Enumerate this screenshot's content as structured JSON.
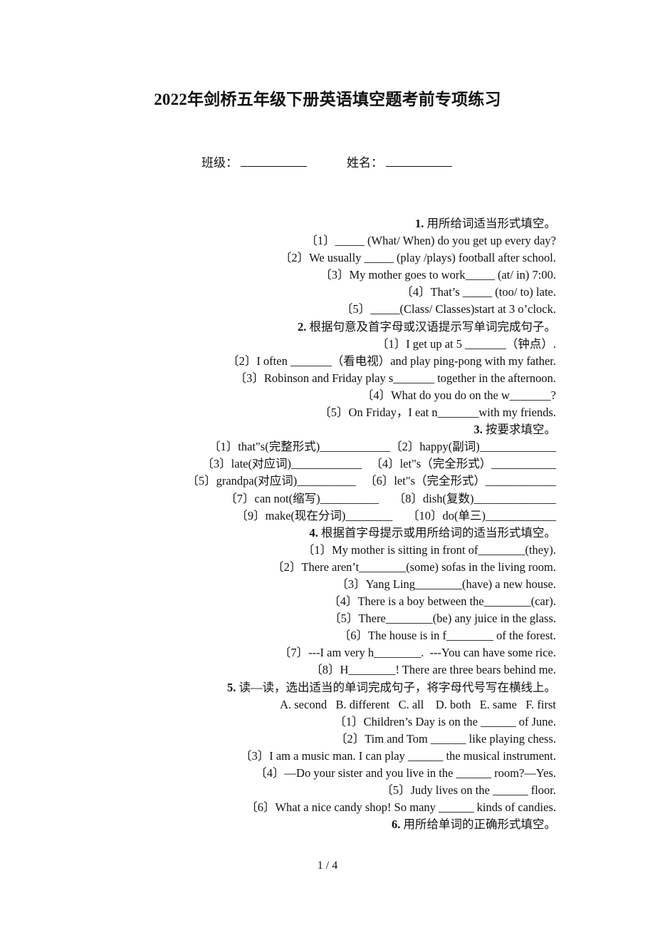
{
  "title": "2022年剑桥五年级下册英语填空题考前专项练习",
  "info": {
    "class_label": "班级：",
    "name_label": "姓名："
  },
  "sections": [
    {
      "number": "1.",
      "heading": "用所给词适当形式填空。",
      "lines": [
        "〔1〕_____ (What/ When) do you get up every day?",
        "〔2〕We usually _____ (play /plays) football after school.",
        "〔3〕My mother goes to work_____ (at/ in) 7:00.",
        "〔4〕That’s _____ (too/ to) late.",
        "〔5〕_____(Class/ Classes)start at 3 o’clock."
      ]
    },
    {
      "number": "2.",
      "heading": "根据句意及首字母或汉语提示写单词完成句子。",
      "lines": [
        "〔1〕I get up at 5 _______（钟点）.",
        "〔2〕I often _______（看电视）and play ping-pong with my father.",
        "〔3〕Robinson and Friday play s_______ together in the afternoon.",
        "〔4〕What do you do on the w_______?",
        "〔5〕On Friday，I eat n_______with my friends."
      ]
    },
    {
      "number": "3.",
      "heading": "按要求填空。",
      "lines": [
        "〔1〕that\"s(完整形式)____________〔2〕happy(副词)_____________",
        "〔3〕late(对应词)____________   〔4〕let\"s（完全形式）___________",
        "〔5〕grandpa(对应词)__________   〔6〕let\"s（完全形式）____________",
        "〔7〕can not(缩写)__________     〔8〕dish(复数)______________",
        "〔9〕make(现在分词)________     〔10〕do(单三)____________"
      ]
    },
    {
      "number": "4.",
      "heading": "根据首字母提示或用所给词的适当形式填空。",
      "lines": [
        "〔1〕My mother is sitting in front of________(they).",
        "〔2〕There aren’t________(some) sofas in the living room.",
        "〔3〕Yang Ling________(have) a new house.",
        "〔4〕There is a boy between the________(car).",
        "〔5〕There________(be) any juice in the glass.",
        "〔6〕The house is in f________ of the forest.",
        "〔7〕---I am very h________.  ---You can have some rice.",
        "〔8〕H________! There are three bears behind me."
      ]
    },
    {
      "number": "5.",
      "heading": "读—读，选出适当的单词完成句子，将字母代号写在横线上。",
      "options": "A. second   B. different   C. all    D. both   E. same   F. first",
      "lines": [
        "〔1〕Children’s Day is on the ______ of June.",
        "〔2〕Tim and Tom ______ like playing chess.",
        "〔3〕I am a music man. I can play ______ the musical instrument.",
        "〔4〕—Do your sister and you live in the ______ room?—Yes.",
        "〔5〕Judy lives on the ______ floor.",
        "〔6〕What a nice candy shop! So many ______ kinds of candies."
      ]
    },
    {
      "number": "6.",
      "heading": "用所给单词的正确形式填空。",
      "lines": []
    }
  ],
  "footer": {
    "page_indicator": "1 / 4"
  }
}
